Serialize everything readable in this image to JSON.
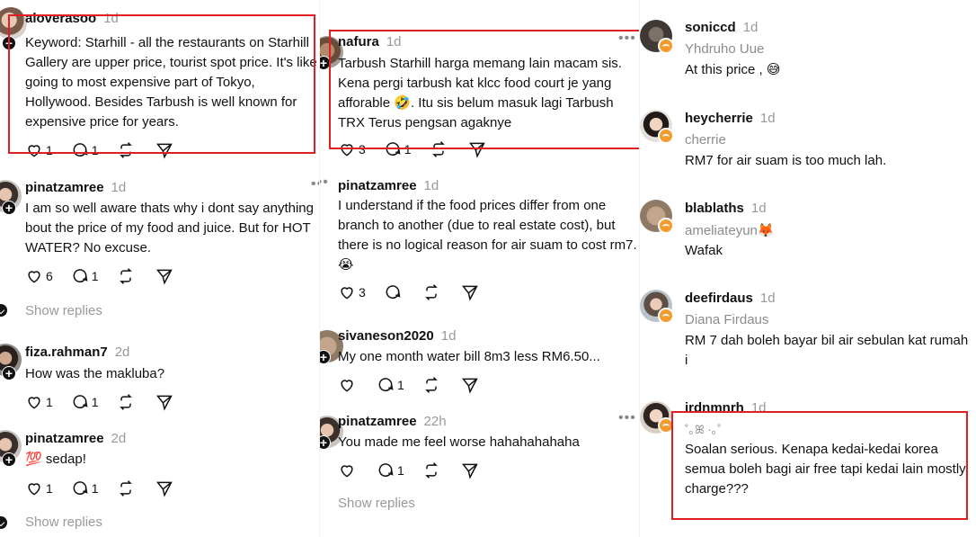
{
  "accent": "#e01e24",
  "col1": {
    "p1": {
      "username": "aloverasoo",
      "time": "1d",
      "text": "Keyword: Starhill - all the restaurants on Starhill Gallery are upper price, tourist spot price. It's like going to most expensive part of Tokyo, Hollywood. Besides Tarbush is well known for expensive price for years.",
      "likes": "1",
      "replies": "1"
    },
    "p2": {
      "username": "pinatzamree",
      "time": "1d",
      "text": "I am so well aware thats why i dont say anything bout the price of my food and juice. But for HOT WATER? No excuse.",
      "likes": "6",
      "replies": "1",
      "show_replies": "Show replies"
    },
    "p3": {
      "username": "fiza.rahman7",
      "time": "2d",
      "text": "How was the makluba?",
      "likes": "1",
      "replies": "1"
    },
    "p4": {
      "username": "pinatzamree",
      "time": "2d",
      "emoji": "💯",
      "text": "sedap!",
      "likes": "1",
      "replies": "1",
      "show_replies": "Show replies"
    }
  },
  "col2": {
    "p1": {
      "username": "nafura",
      "time": "1d",
      "text": "Tarbush Starhill harga memang lain macam sis. Kena pergi tarbush kat klcc food court je yang afforable 🤣. Itu sis belum masuk lagi Tarbush TRX Terus pengsan agaknye",
      "likes": "3",
      "replies": "1"
    },
    "p2": {
      "username": "pinatzamree",
      "time": "1d",
      "text": "I understand if the food prices differ from one branch to another (due to real estate cost), but there is no logical reason for air suam to cost rm7. 😭",
      "likes": "3"
    },
    "p3": {
      "username": "sivaneson2020",
      "time": "1d",
      "text": "My one month water bill  8m3 less RM6.50...",
      "replies": "1"
    },
    "p4": {
      "username": "pinatzamree",
      "time": "22h",
      "text": "You made me feel worse hahahahahaha",
      "replies": "1",
      "show_replies": "Show replies"
    }
  },
  "col3": {
    "p1": {
      "username": "soniccd",
      "time": "1d",
      "subname": "Yhdruho Uue",
      "text": "At this price , 😅"
    },
    "p2": {
      "username": "heycherrie",
      "time": "1d",
      "subname": "cherrie",
      "text": "RM7 for air suam is too much lah."
    },
    "p3": {
      "username": "blablaths",
      "time": "1d",
      "subname": "ameliateyun🦊",
      "text": "Wafak"
    },
    "p4": {
      "username": "deefirdaus",
      "time": "1d",
      "subname": "Diana Firdaus",
      "text": "RM 7 dah boleh bayar bil air sebulan kat rumah i"
    },
    "p5": {
      "username": "irdnmnrh",
      "time": "1d",
      "subname": "˚｡ꕤ ·｡˚",
      "text": "Soalan serious. Kenapa kedai-kedai korea semua boleh bagi air free tapi kedai lain mostly charge???"
    }
  }
}
